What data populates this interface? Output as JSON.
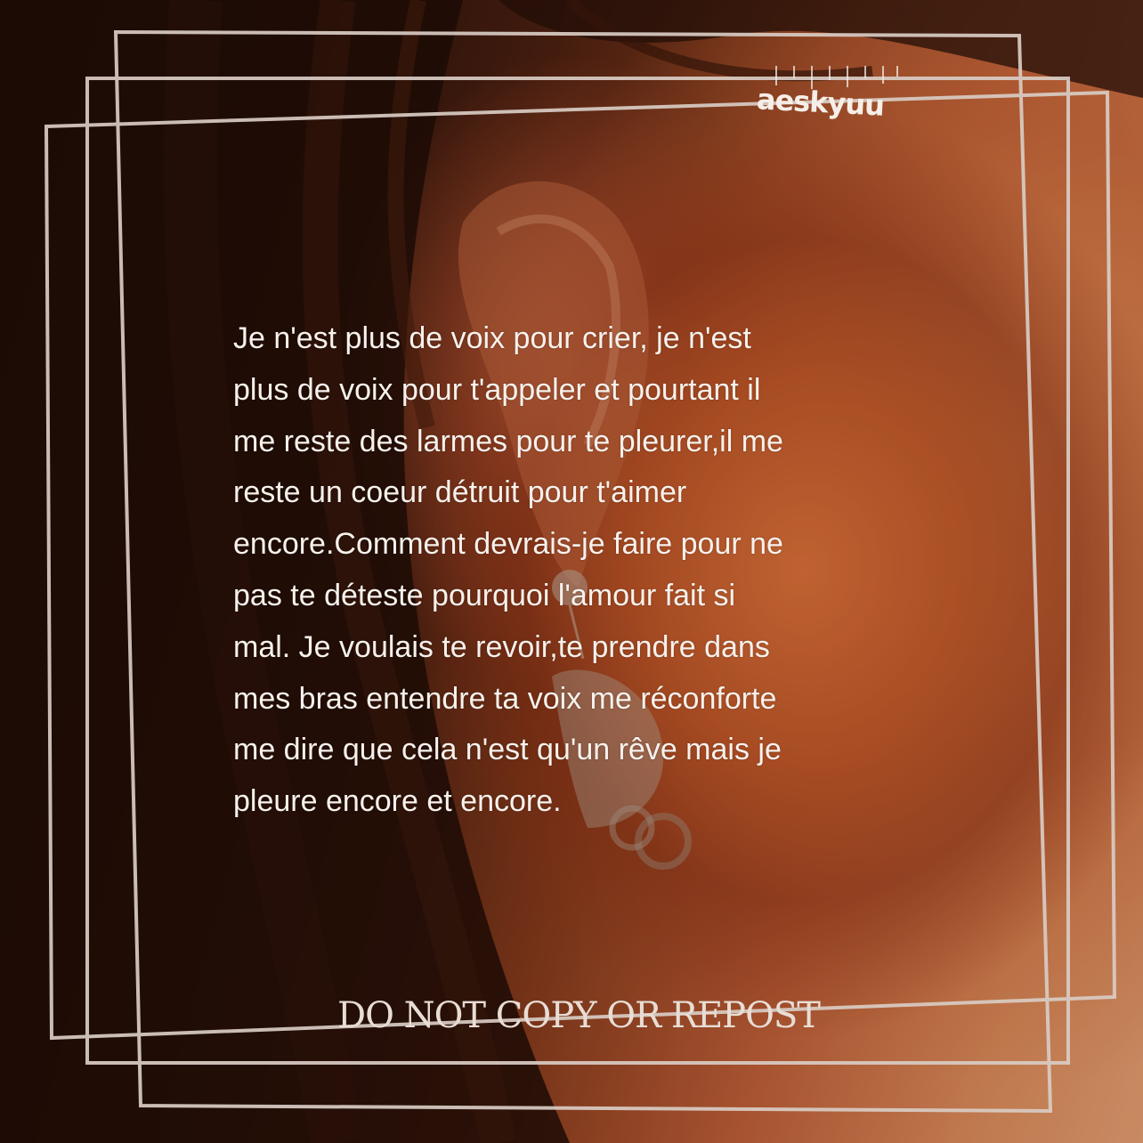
{
  "watermark": {
    "handle": "aeskyuu"
  },
  "poem": {
    "text": "Je n'est plus de voix pour crier, je n'est\nplus de voix pour t'appeler et pourtant il\nme reste des larmes pour te pleurer,il me\nreste un coeur détruit pour t'aimer\nencore.Comment devrais-je faire pour ne\npas te déteste pourquoi l'amour fait si\nmal. Je voulais te revoir,te prendre dans\nmes bras entendre ta voix me réconforte\nme dire que cela n'est qu'un rêve mais je\npleure encore et encore."
  },
  "footer": {
    "notice": "DO NOT COPY OR REPOST"
  },
  "colors": {
    "frame_stroke": "#d9ccc4",
    "text": "#f7f1ec",
    "skin_warm": "#e6935f",
    "hair_dark": "#1c0d07"
  }
}
